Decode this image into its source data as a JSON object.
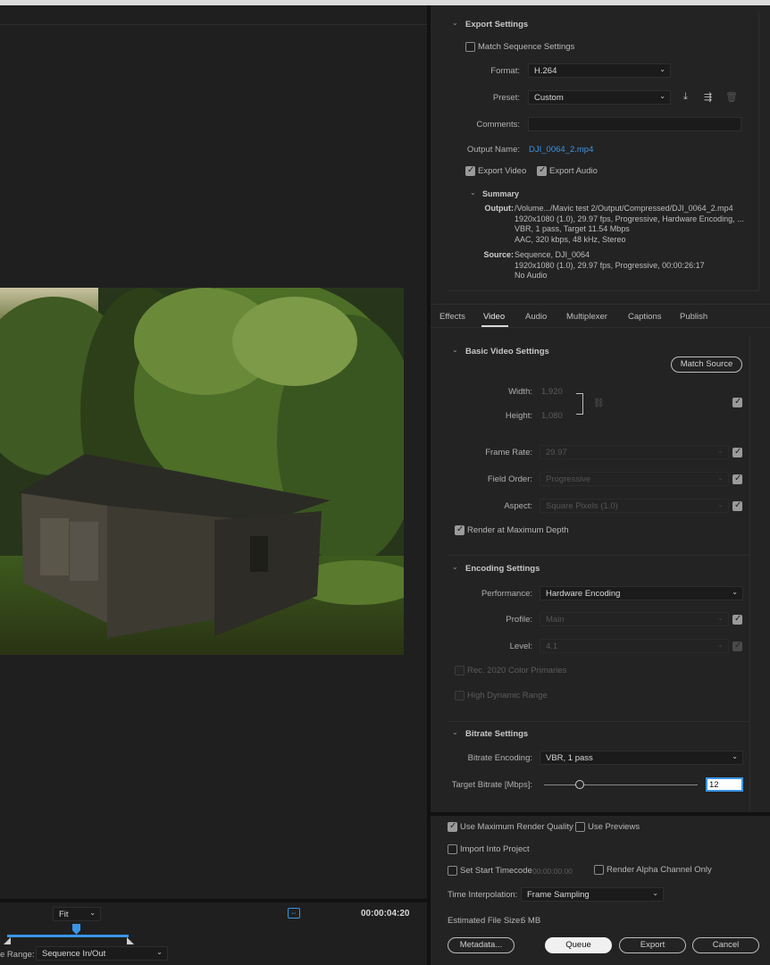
{
  "export_settings": {
    "title": "Export Settings",
    "match_sequence_label": "Match Sequence Settings",
    "format_label": "Format:",
    "format_value": "H.264",
    "preset_label": "Preset:",
    "preset_value": "Custom",
    "comments_label": "Comments:",
    "comments_value": "",
    "output_name_label": "Output Name:",
    "output_name_value": "DJI_0064_2.mp4",
    "export_video_label": "Export Video",
    "export_audio_label": "Export Audio",
    "summary": {
      "title": "Summary",
      "output_label": "Output:",
      "output_lines": [
        "/Volume.../Mavic test 2/Output/Compressed/DJI_0064_2.mp4",
        "1920x1080 (1.0), 29.97 fps, Progressive, Hardware Encoding, ...",
        "VBR, 1 pass, Target 11.54 Mbps",
        "AAC, 320 kbps, 48 kHz, Stereo"
      ],
      "source_label": "Source:",
      "source_lines": [
        "Sequence, DJI_0064",
        "1920x1080 (1.0), 29.97 fps, Progressive, 00:00:26:17",
        "No Audio"
      ]
    }
  },
  "tabs": [
    "Effects",
    "Video",
    "Audio",
    "Multiplexer",
    "Captions",
    "Publish"
  ],
  "active_tab": "Video",
  "basic_video": {
    "title": "Basic Video Settings",
    "match_source_label": "Match Source",
    "width_label": "Width:",
    "width_value": "1,920",
    "height_label": "Height:",
    "height_value": "1,080",
    "frame_rate_label": "Frame Rate:",
    "frame_rate_value": "29.97",
    "field_order_label": "Field Order:",
    "field_order_value": "Progressive",
    "aspect_label": "Aspect:",
    "aspect_value": "Square Pixels (1.0)",
    "render_max_depth_label": "Render at Maximum Depth"
  },
  "encoding": {
    "title": "Encoding Settings",
    "performance_label": "Performance:",
    "performance_value": "Hardware Encoding",
    "profile_label": "Profile:",
    "profile_value": "Main",
    "level_label": "Level:",
    "level_value": "4.1",
    "rec2020_label": "Rec. 2020 Color Primaries",
    "hdr_label": "High Dynamic Range"
  },
  "bitrate": {
    "title": "Bitrate Settings",
    "encoding_label": "Bitrate Encoding:",
    "encoding_value": "VBR, 1 pass",
    "target_label": "Target Bitrate [Mbps]:",
    "target_value": "12",
    "slider_fraction": 0.23
  },
  "bottom": {
    "max_render_quality_label": "Use Maximum Render Quality",
    "use_previews_label": "Use Previews",
    "import_project_label": "Import Into Project",
    "set_start_timecode_label": "Set Start Timecode",
    "start_timecode_value": "00:00:00:00",
    "render_alpha_label": "Render Alpha Channel Only",
    "time_interp_label": "Time Interpolation:",
    "time_interp_value": "Frame Sampling",
    "est_size_label": "Estimated File Size:",
    "est_size_value": "6 MB",
    "metadata_label": "Metadata...",
    "queue_label": "Queue",
    "export_label": "Export",
    "cancel_label": "Cancel"
  },
  "preview": {
    "fit_value": "Fit",
    "timecode": "00:00:04:20",
    "source_range_label": "e Range:",
    "source_range_value": "Sequence In/Out"
  },
  "colors": {
    "accent_blue": "#3a95e6",
    "panel_bg": "#232323",
    "queue_button": "#f0f0f0"
  }
}
